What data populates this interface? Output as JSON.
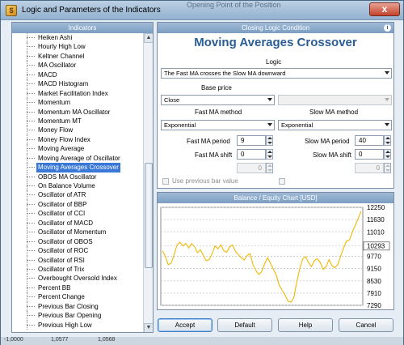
{
  "window": {
    "title": "Logic and Parameters of the Indicators",
    "background_title": "Opening Point of the Position",
    "close_label": "x"
  },
  "indicators_panel": {
    "caption": "Indicators",
    "items": [
      "Heiken Ashi",
      "Hourly High Low",
      "Keltner Channel",
      "MA Oscillator",
      "MACD",
      "MACD Histogram",
      "Market Facilitation Index",
      "Momentum",
      "Momentum MA Oscillator",
      "Momentum MT",
      "Money Flow",
      "Money Flow Index",
      "Moving Average",
      "Moving Average of Oscillator",
      "Moving Averages Crossover",
      "OBOS MA Oscillator",
      "On Balance Volume",
      "Oscillator of ATR",
      "Oscillator of BBP",
      "Oscillator of CCI",
      "Oscillator of MACD",
      "Oscillator of Momentum",
      "Oscillator of OBOS",
      "Oscillator of ROC",
      "Oscillator of RSI",
      "Oscillator of Trix",
      "Overbought Oversold Index",
      "Percent BB",
      "Percent Change",
      "Previous Bar Closing",
      "Previous Bar Opening",
      "Previous High Low"
    ],
    "selected_index": 14
  },
  "logic_panel": {
    "caption": "Closing Logic Condition",
    "indicator_title": "Moving Averages Crossover",
    "logic_label": "Logic",
    "logic_value": "The Fast MA crosses the Slow MA downward",
    "base_price_label": "Base price",
    "base_price_value": "Close",
    "fast_method_label": "Fast MA method",
    "fast_method_value": "Exponential",
    "slow_method_label": "Slow MA method",
    "slow_method_value": "Exponential",
    "fast_period_label": "Fast MA period",
    "fast_period_value": "9",
    "fast_shift_label": "Fast MA shift",
    "fast_shift_value": "0",
    "slow_period_label": "Slow MA period",
    "slow_period_value": "40",
    "slow_shift_label": "Slow MA shift",
    "slow_shift_value": "0",
    "extra_left_value": "0",
    "extra_right_value": "0",
    "use_previous_bar_label": "Use previous bar value"
  },
  "chart_panel": {
    "caption": "Balance / Equity Chart [USD]"
  },
  "chart_data": {
    "type": "line",
    "title": "Balance / Equity Chart [USD]",
    "y_ticks": [
      12250,
      11630,
      11010,
      10293,
      9770,
      9150,
      8530,
      7910,
      7290
    ],
    "highlighted_tick": 10293,
    "ylim": [
      7290,
      12250
    ],
    "series": [
      {
        "color": "#f2b800",
        "values": [
          10050,
          9780,
          9350,
          9420,
          9850,
          10350,
          10480,
          10300,
          10420,
          10200,
          10410,
          10250,
          9950,
          10100,
          9820,
          9550,
          9600,
          9900,
          10300,
          10150,
          10350,
          10050,
          9980,
          10250,
          10350,
          10020,
          9850,
          9700,
          9580,
          9820,
          9900,
          9350,
          9050,
          8850,
          9000,
          9400,
          9700,
          9400,
          9100,
          8800,
          8300,
          8050,
          7800,
          7500,
          7450,
          7700,
          8500,
          9150,
          9650,
          9750,
          9450,
          9250,
          9550,
          9650,
          9450,
          9100,
          9250,
          9600,
          9300,
          9200,
          9350,
          9800,
          10200,
          10550,
          10600,
          11000,
          11350,
          11700,
          12050
        ]
      },
      {
        "color": "#555d7a",
        "values": [
          10100,
          10100,
          9950,
          9950,
          10250,
          10250,
          10250,
          10250,
          10250,
          10200,
          10200,
          10200,
          10200,
          9650,
          9650,
          9650,
          9650,
          9650,
          10150,
          10150,
          10150,
          10150,
          10150,
          10150,
          10150,
          10150,
          9650,
          9650,
          9650,
          9650,
          9650,
          9650,
          9650,
          9000,
          9000,
          9000,
          9000,
          9000,
          9000,
          9000,
          8500,
          8500,
          7600,
          7600,
          7400,
          7400,
          9200,
          9200,
          9200,
          9200,
          9200,
          9200,
          9200,
          9200,
          9200,
          9200,
          9200,
          9200,
          9200,
          9200,
          9200,
          9600,
          9600,
          10300,
          10300,
          10950,
          10950,
          10950,
          10950
        ]
      }
    ]
  },
  "buttons": {
    "accept": "Accept",
    "default": "Default",
    "help": "Help",
    "cancel": "Cancel"
  },
  "background_strip": [
    "-1,0000",
    "1,0577",
    "1,0568"
  ],
  "colors": {
    "caption_bg": "#8caed0",
    "title_blue": "#2a5c96",
    "selection": "#3a78d8",
    "balance_line": "#555d7a",
    "equity_line": "#f2b800"
  }
}
